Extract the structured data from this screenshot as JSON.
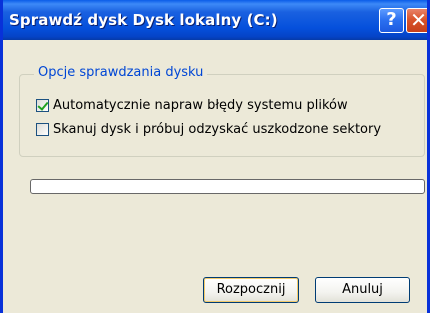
{
  "window": {
    "title": "Sprawdź dysk Dysk lokalny (C:)",
    "help_label": "?",
    "close_label": "✕"
  },
  "options": {
    "legend": "Opcje sprawdzania dysku",
    "auto_fix": {
      "label": "Automatycznie napraw błędy systemu plików",
      "checked": true
    },
    "scan_sectors": {
      "label": "Skanuj dysk i próbuj odzyskać uszkodzone sektory",
      "checked": false
    }
  },
  "progress": {
    "value": 0
  },
  "buttons": {
    "start": "Rozpocznij",
    "cancel": "Anuluj"
  },
  "colors": {
    "titlebar": "#0550dc",
    "legend": "#0046d5",
    "check": "#21a121",
    "dialog_bg": "#ece9d8"
  }
}
